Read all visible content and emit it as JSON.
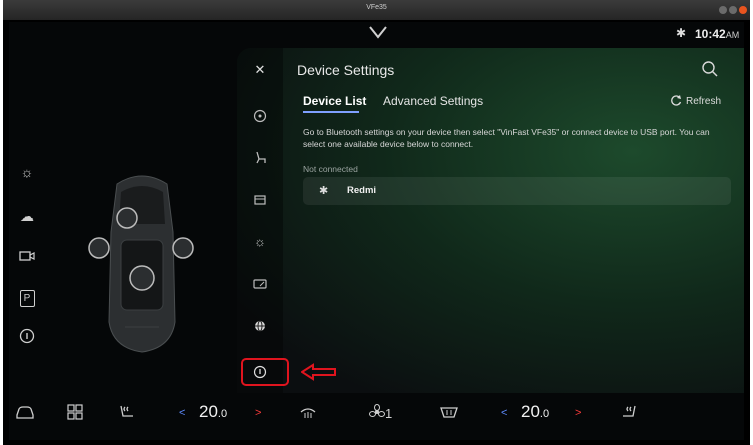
{
  "window": {
    "title": "VFe35"
  },
  "status": {
    "time": "10:42",
    "ampm": "AM",
    "icons": [
      "chevron-down-icon",
      "bluetooth-icon"
    ]
  },
  "left_rail": {
    "icons": [
      "sun-icon",
      "cloud-icon",
      "camera-icon",
      "parking-icon",
      "info-icon"
    ],
    "parking_label": "P"
  },
  "panel": {
    "title": "Device Settings",
    "tabs": [
      {
        "label": "Device List",
        "active": true
      },
      {
        "label": "Advanced Settings",
        "active": false
      }
    ],
    "refresh_label": "Refresh",
    "description": "Go to Bluetooth settings on your device then select \"VinFast VFe35\" or connect device to USB port. You can select one available device below to connect.",
    "section_label": "Not connected",
    "devices": [
      {
        "name": "Redmi",
        "icon": "bluetooth-icon"
      }
    ],
    "side_icons": [
      "close-icon",
      "steering-wheel-icon",
      "seat-icon",
      "display-icon",
      "brightness-icon",
      "screen-icon",
      "globe-icon",
      "info-icon"
    ]
  },
  "annotations": {
    "highlight_color": "#e0141e"
  },
  "climate": {
    "left_temp": "20",
    "left_temp_decimal": ".0",
    "right_temp": "20",
    "right_temp_decimal": ".0",
    "fan_level": "1",
    "decrease_symbol": "<",
    "increase_symbol": ">",
    "icons": [
      "car-icon",
      "apps-icon",
      "seat-heat-icon",
      "rear-defrost-icon",
      "fan-icon",
      "front-defrost-icon",
      "seat-heat-right-icon"
    ]
  },
  "colors": {
    "accent_blue": "#5f8cff",
    "accent_red": "#ff3b3b",
    "panel_green": "#1d4a2c"
  }
}
